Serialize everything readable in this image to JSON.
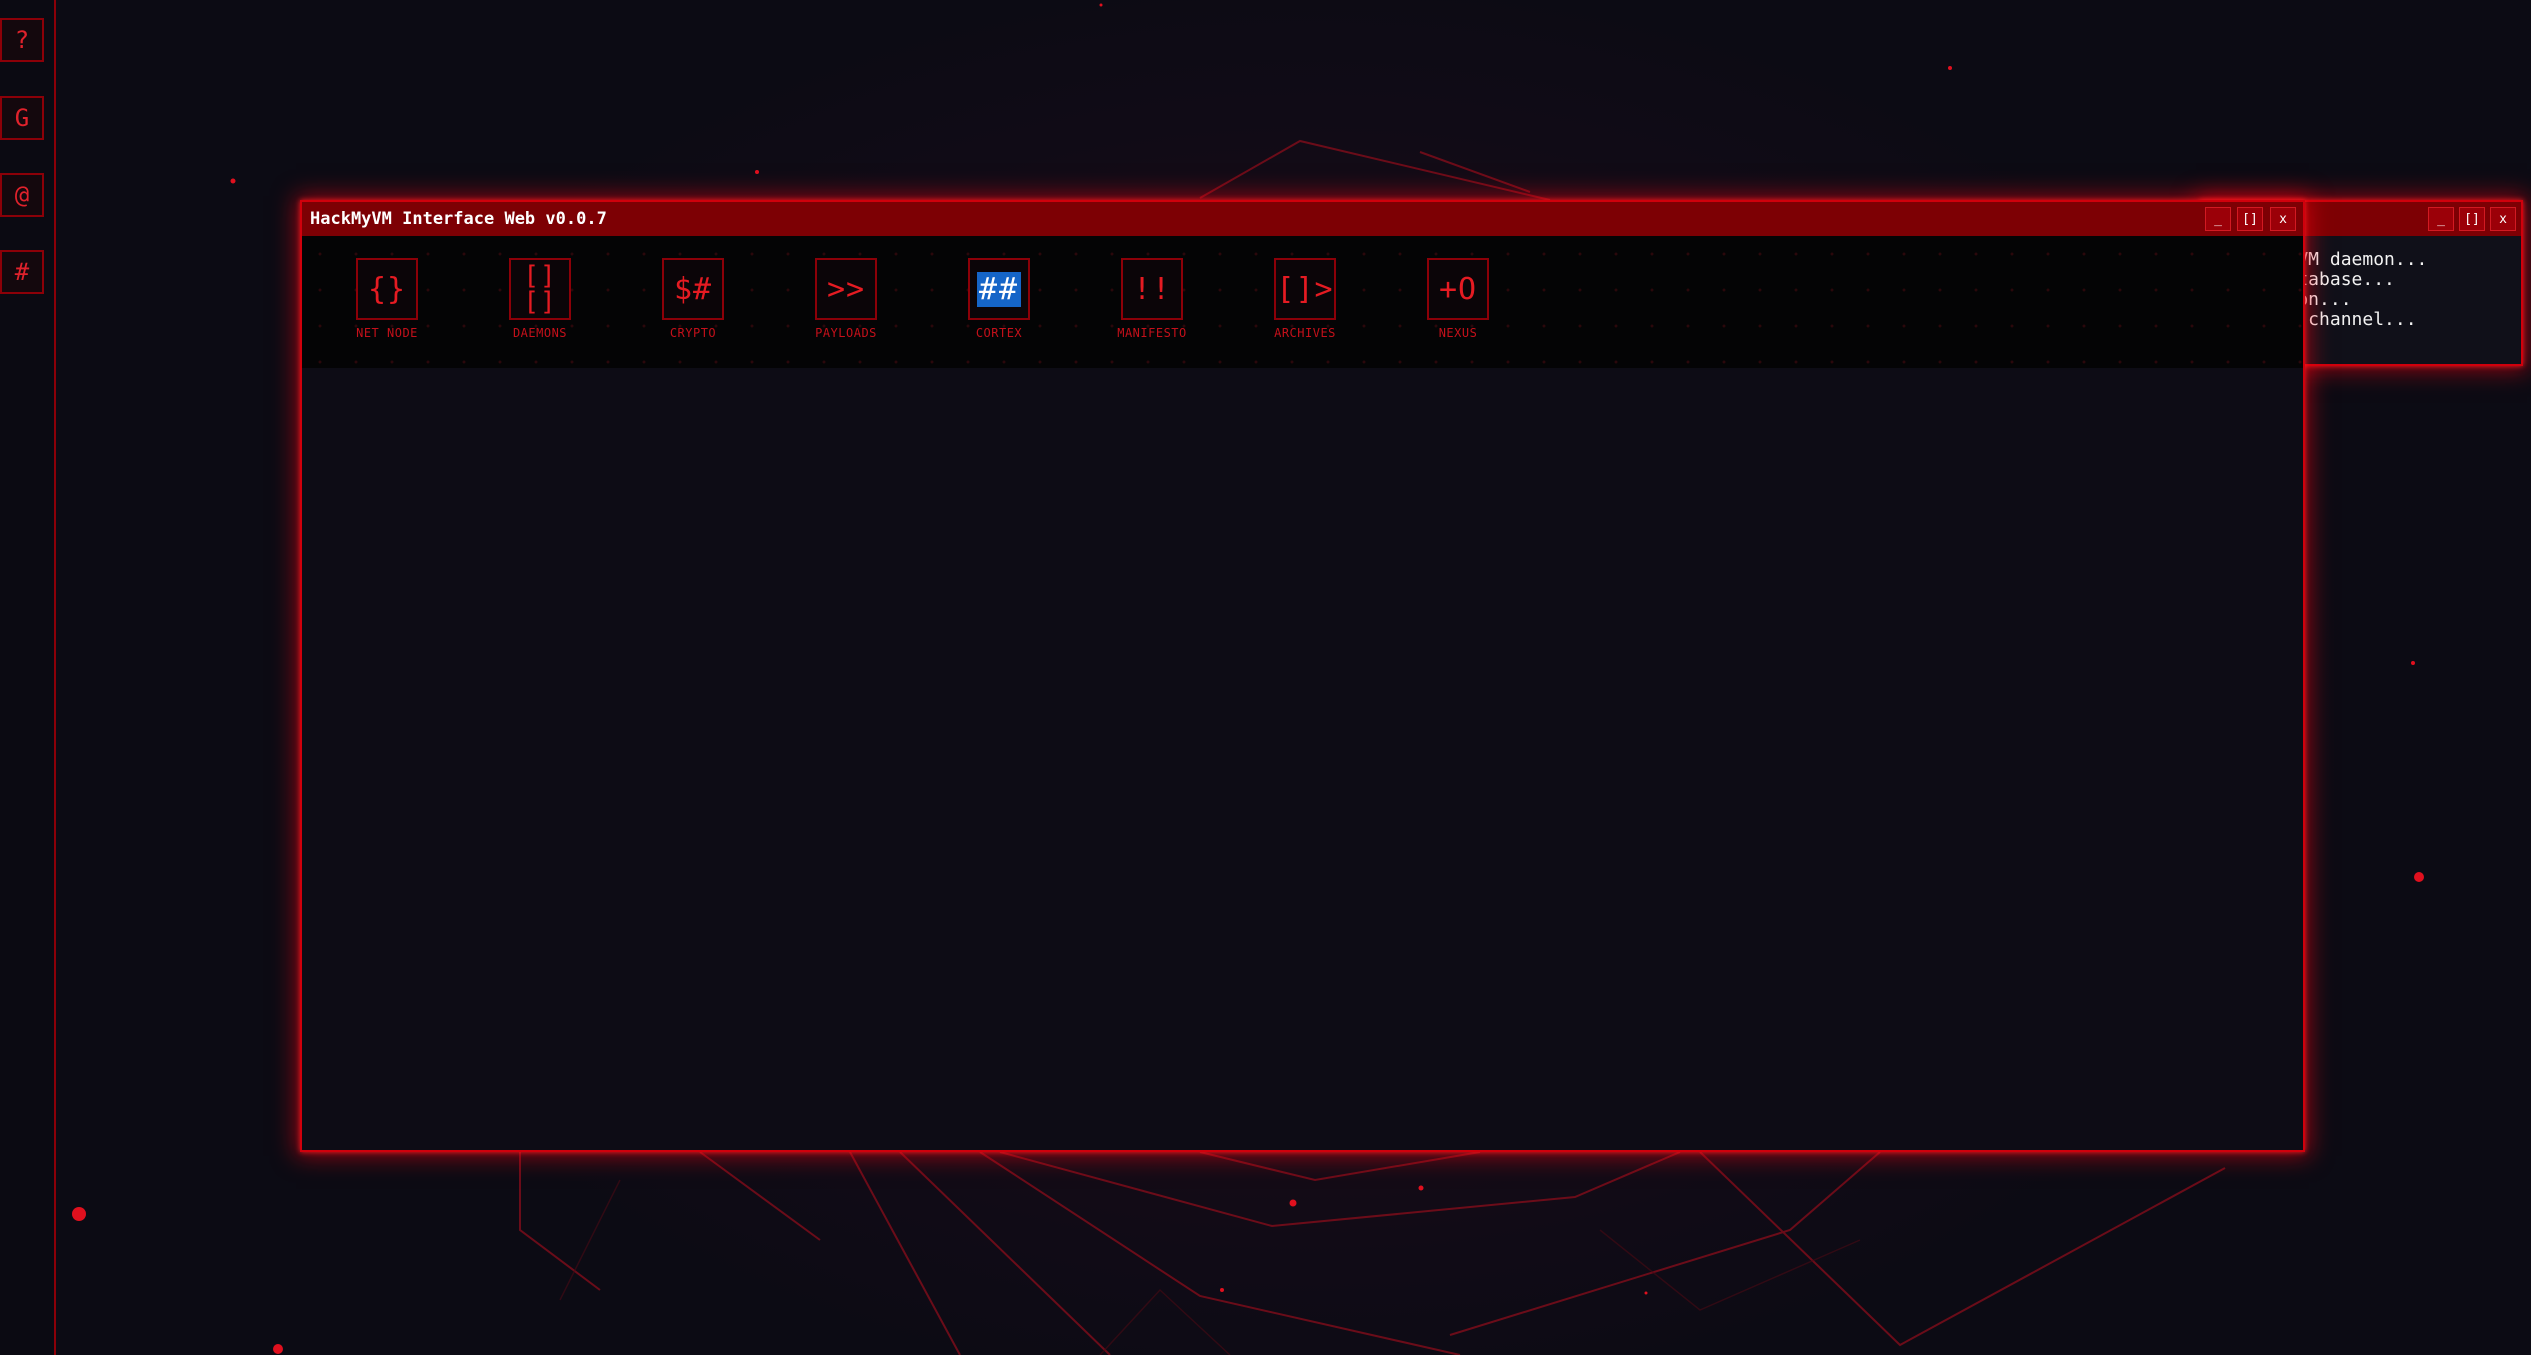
{
  "dock": {
    "items": [
      {
        "glyph": "?",
        "name": "help"
      },
      {
        "glyph": "G",
        "name": "g"
      },
      {
        "glyph": "@",
        "name": "at"
      },
      {
        "glyph": "#",
        "name": "hash"
      }
    ]
  },
  "main_window": {
    "title": "HackMyVM Interface Web v0.0.7",
    "controls": {
      "minimize": "_",
      "maximize": "[]",
      "close": "x"
    },
    "apps": [
      {
        "icon": "{}",
        "label": "NET NODE"
      },
      {
        "icon": "[]\n[]",
        "label": "DAEMONS"
      },
      {
        "icon": "$#",
        "label": "CRYPTO"
      },
      {
        "icon": ">>",
        "label": "PAYLOADS"
      },
      {
        "icon": "##",
        "label": "CORTEX",
        "selected": true
      },
      {
        "icon": "!!",
        "label": "MANIFESTO"
      },
      {
        "icon": "[]>",
        "label": "ARCHIVES"
      },
      {
        "icon": "+O",
        "label": "NEXUS"
      }
    ]
  },
  "console_window": {
    "controls": {
      "minimize": "_",
      "maximize": "[]",
      "close": "x"
    },
    "lines": [
      "ckMyVM daemon...",
      "l database...",
      "ection...",
      "cure channel..."
    ]
  },
  "colors": {
    "accent": "#e0222c",
    "titlebar": "#7d0004",
    "border": "#d0000c",
    "selection": "#1565c8",
    "background": "#0c0b14"
  }
}
